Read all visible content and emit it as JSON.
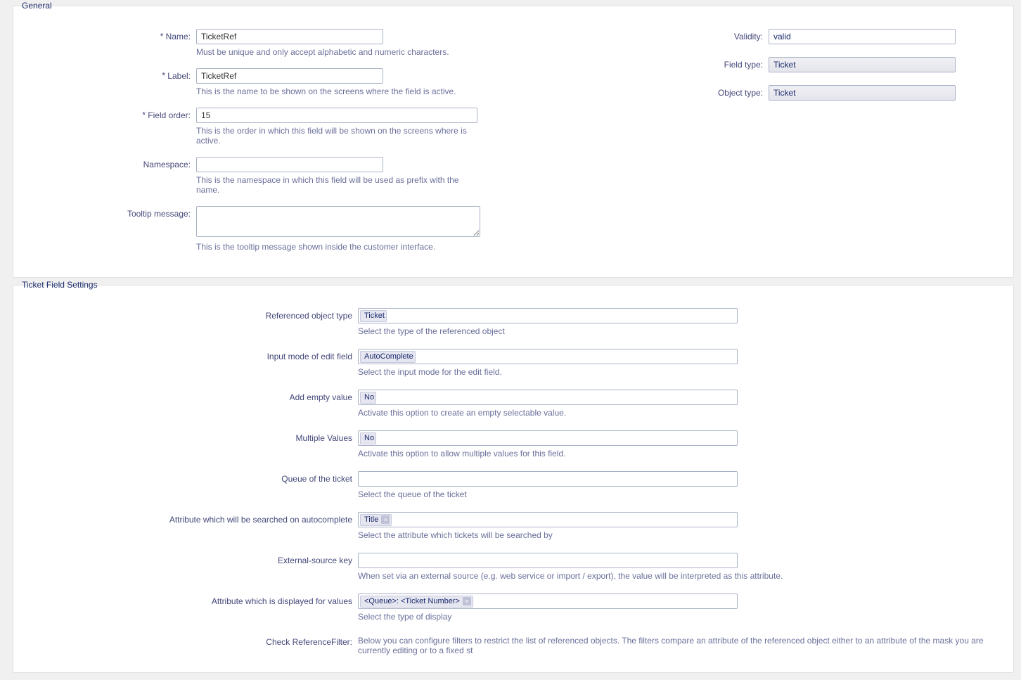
{
  "general": {
    "title": "General",
    "name": {
      "label": "Name:",
      "value": "TicketRef",
      "hint": "Must be unique and only accept alphabetic and numeric characters."
    },
    "label_field": {
      "label": "Label:",
      "value": "TicketRef",
      "hint": "This is the name to be shown on the screens where the field is active."
    },
    "field_order": {
      "label": "Field order:",
      "value": "15",
      "hint": "This is the order in which this field will be shown on the screens where is active."
    },
    "namespace": {
      "label": "Namespace:",
      "value": "",
      "hint": "This is the namespace in which this field will be used as prefix with the name."
    },
    "tooltip": {
      "label": "Tooltip message:",
      "value": "",
      "hint": "This is the tooltip message shown inside the customer interface."
    },
    "validity": {
      "label": "Validity:",
      "value": "valid"
    },
    "field_type": {
      "label": "Field type:",
      "value": "Ticket"
    },
    "object_type": {
      "label": "Object type:",
      "value": "Ticket"
    }
  },
  "settings": {
    "title": "Ticket Field Settings",
    "ref_object_type": {
      "label": "Referenced object type",
      "value": "Ticket",
      "hint": "Select the type of the referenced object"
    },
    "input_mode": {
      "label": "Input mode of edit field",
      "value": "AutoComplete",
      "hint": "Select the input mode for the edit field."
    },
    "add_empty": {
      "label": "Add empty value",
      "value": "No",
      "hint": "Activate this option to create an empty selectable value."
    },
    "multiple_values": {
      "label": "Multiple Values",
      "value": "No",
      "hint": "Activate this option to allow multiple values for this field."
    },
    "queue": {
      "label": "Queue of the ticket",
      "value": "",
      "hint": "Select the queue of the ticket"
    },
    "search_attr": {
      "label": "Attribute which will be searched on autocomplete",
      "tag": "Title",
      "hint": "Select the attribute which tickets will be searched by"
    },
    "ext_source": {
      "label": "External-source key",
      "value": "",
      "hint": "When set via an external source (e.g. web service or import / export), the value will be interpreted as this attribute."
    },
    "display_attr": {
      "label": "Attribute which is displayed for values",
      "tag": "<Queue>: <Ticket Number>",
      "hint": "Select the type of display"
    },
    "check_filter": {
      "label": "Check ReferenceFilter:",
      "hint": "Below you can configure filters to restrict the list of referenced objects. The filters compare an attribute of the referenced object either to an attribute of the mask you are currently editing or to a fixed st"
    }
  }
}
